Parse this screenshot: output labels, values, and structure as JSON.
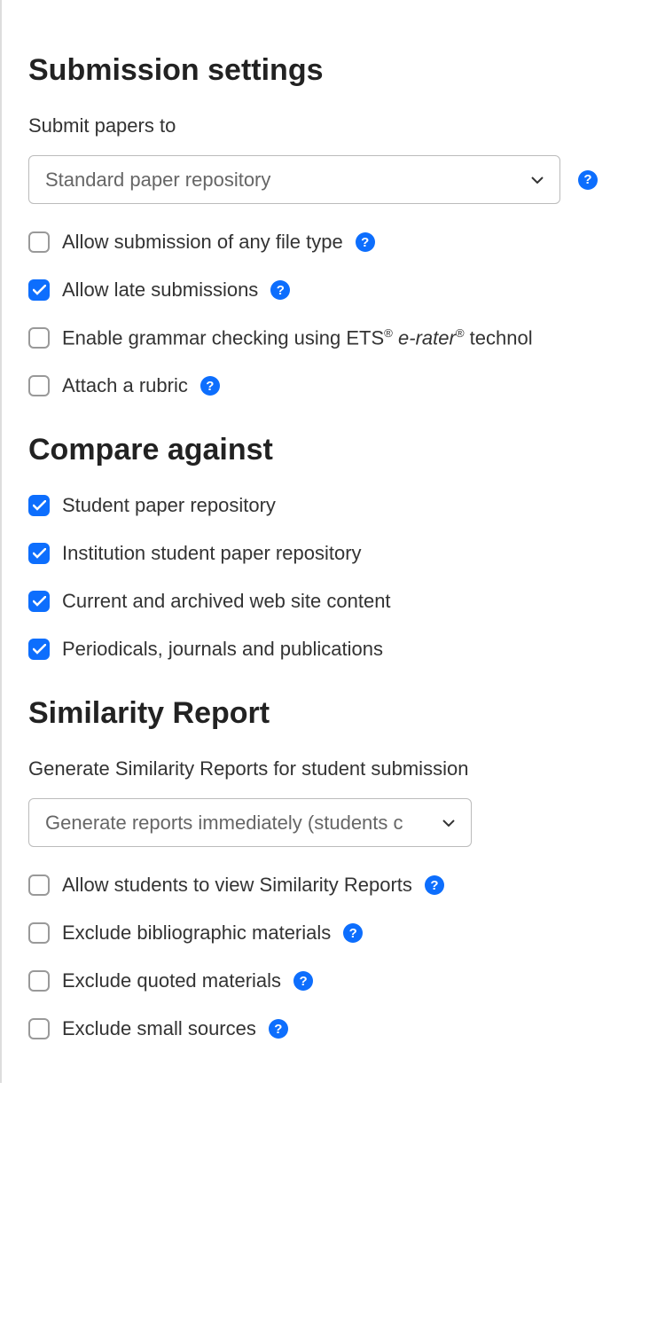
{
  "sections": {
    "submission": {
      "heading": "Submission settings",
      "submit_to_label": "Submit papers to",
      "submit_to_value": "Standard paper repository",
      "options": {
        "allow_any_file": {
          "label": "Allow submission of any file type",
          "checked": false,
          "help": true
        },
        "allow_late": {
          "label": "Allow late submissions",
          "checked": true,
          "help": true
        },
        "grammar_prefix": "Enable grammar checking using ETS",
        "grammar_erater": "e-rater",
        "grammar_suffix": "technol",
        "grammar_checked": false,
        "attach_rubric": {
          "label": "Attach a rubric",
          "checked": false,
          "help": true
        }
      }
    },
    "compare": {
      "heading": "Compare against",
      "options": {
        "student_repo": {
          "label": "Student paper repository",
          "checked": true
        },
        "institution_repo": {
          "label": "Institution student paper repository",
          "checked": true
        },
        "web_content": {
          "label": "Current and archived web site content",
          "checked": true
        },
        "periodicals": {
          "label": "Periodicals, journals and publications",
          "checked": true
        }
      }
    },
    "similarity": {
      "heading": "Similarity Report",
      "generate_label": "Generate Similarity Reports for student submission",
      "generate_value": "Generate reports immediately (students c",
      "options": {
        "allow_view": {
          "label": "Allow students to view Similarity Reports",
          "checked": false,
          "help": true
        },
        "exclude_biblio": {
          "label": "Exclude bibliographic materials",
          "checked": false,
          "help": true
        },
        "exclude_quoted": {
          "label": "Exclude quoted materials",
          "checked": false,
          "help": true
        },
        "exclude_small": {
          "label": "Exclude small sources",
          "checked": false,
          "help": true
        }
      }
    }
  },
  "reg_mark": "®"
}
